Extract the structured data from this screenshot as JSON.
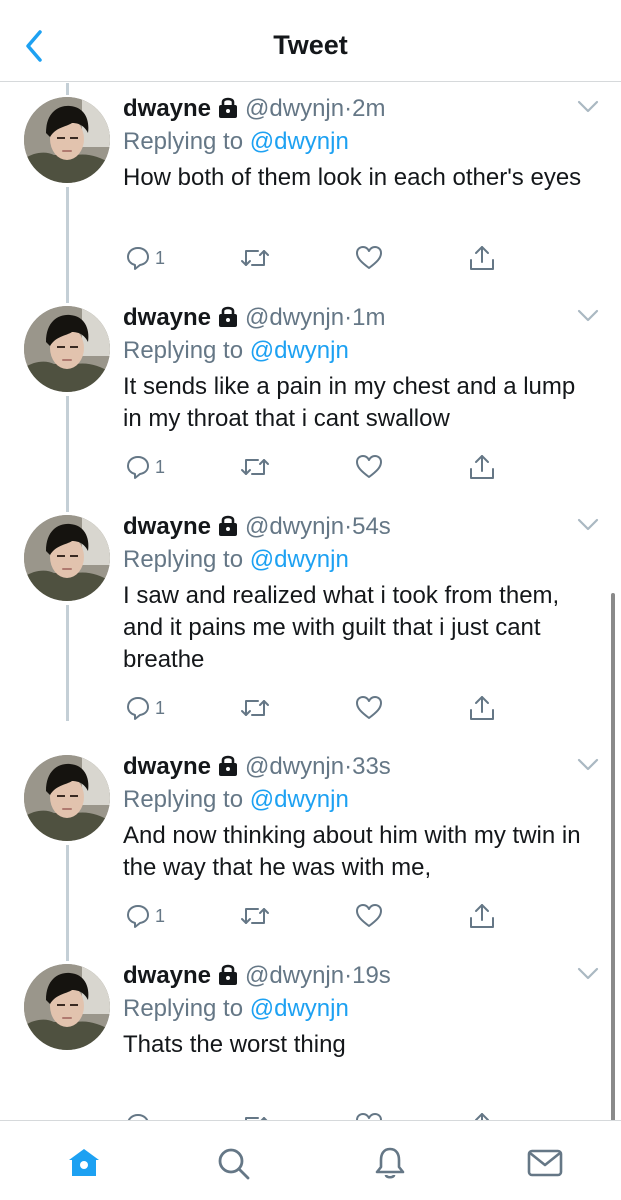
{
  "header": {
    "title": "Tweet",
    "back_icon": "chevron-left-icon"
  },
  "tweets": [
    {
      "name": "dwayne",
      "handle": "@dwynjn",
      "dot": "·",
      "time": "2m",
      "reply_prefix": "Replying to ",
      "reply_to": "@dwynjn",
      "text": "How both of them look in each other's eyes",
      "reply_count": "1",
      "retweet_count": "",
      "like_count": ""
    },
    {
      "name": "dwayne",
      "handle": "@dwynjn",
      "dot": "·",
      "time": "1m",
      "reply_prefix": "Replying to ",
      "reply_to": "@dwynjn",
      "text": "It sends like a pain in my chest and a lump in my throat that i cant swallow",
      "reply_count": "1",
      "retweet_count": "",
      "like_count": ""
    },
    {
      "name": "dwayne",
      "handle": "@dwynjn",
      "dot": "·",
      "time": "54s",
      "reply_prefix": "Replying to ",
      "reply_to": "@dwynjn",
      "text": "I saw and realized what i took from them, and it pains me with guilt that i just cant breathe",
      "reply_count": "1",
      "retweet_count": "",
      "like_count": ""
    },
    {
      "name": "dwayne",
      "handle": "@dwynjn",
      "dot": "·",
      "time": "33s",
      "reply_prefix": "Replying to ",
      "reply_to": "@dwynjn",
      "text": "And now thinking about him with my twin in the way that he was with me,",
      "reply_count": "1",
      "retweet_count": "",
      "like_count": ""
    },
    {
      "name": "dwayne",
      "handle": "@dwynjn",
      "dot": "·",
      "time": "19s",
      "reply_prefix": "Replying to ",
      "reply_to": "@dwynjn",
      "text": "Thats the worst thing",
      "reply_count": "",
      "retweet_count": "",
      "like_count": ""
    }
  ],
  "icons": {
    "lock": "lock-icon",
    "reply": "reply-icon",
    "retweet": "retweet-icon",
    "like": "heart-icon",
    "share": "share-icon",
    "more": "chevron-down-icon"
  },
  "tabbar": {
    "items": [
      {
        "icon": "home-icon",
        "active": true
      },
      {
        "icon": "search-icon",
        "active": false
      },
      {
        "icon": "bell-icon",
        "active": false
      },
      {
        "icon": "mail-icon",
        "active": false
      }
    ]
  },
  "colors": {
    "accent": "#1da1f2",
    "secondary_text": "#657786",
    "primary_text": "#14171a",
    "divider": "#d6d9db",
    "thread_line": "#c4cfd6"
  }
}
